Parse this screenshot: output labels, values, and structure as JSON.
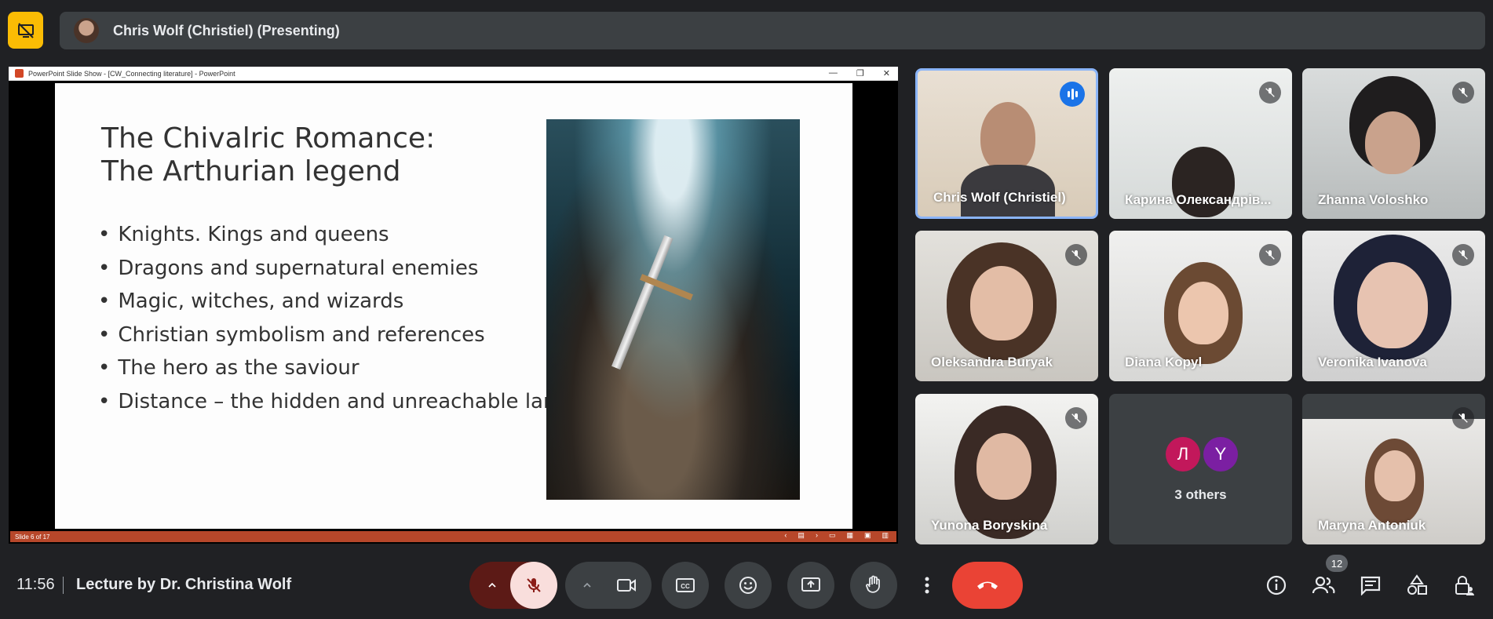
{
  "header": {
    "presenter_label": "Chris Wolf (Christiel) (Presenting)"
  },
  "shared_screen": {
    "window_title": "PowerPoint Slide Show - [CW_Connecting literature] - PowerPoint",
    "slide": {
      "title_line1": "The Chivalric Romance:",
      "title_line2": "The Arthurian legend",
      "bullets": [
        "Knights. Kings and queens",
        "Dragons and supernatural enemies",
        "Magic, witches, and wizards",
        "Christian symbolism and references",
        "The hero as the saviour",
        "Distance – the hidden and unreachable land"
      ]
    },
    "status_text": "Slide 6 of 17"
  },
  "participants": [
    {
      "name": "Chris Wolf (Christiel)",
      "speaking": true
    },
    {
      "name": "Карина Олександрів...",
      "muted": true
    },
    {
      "name": "Zhanna Voloshko",
      "muted": true
    },
    {
      "name": "Oleksandra Buryak",
      "muted": true
    },
    {
      "name": "Diana Kopyl",
      "muted": true
    },
    {
      "name": "Veronika Ivanova",
      "muted": true
    },
    {
      "name": "Yunona Boryskina",
      "muted": true
    },
    {
      "name": "Maryna Antoniuk",
      "muted": true
    }
  ],
  "others_tile": {
    "avatars": [
      {
        "letter": "Л",
        "color": "#c2185b"
      },
      {
        "letter": "Y",
        "color": "#7b1fa2"
      }
    ],
    "label": "3 others"
  },
  "bottom_bar": {
    "time": "11:56",
    "meeting_title": "Lecture by Dr. Christina Wolf",
    "people_count": "12"
  },
  "colors": {
    "background": "#202124",
    "surface": "#3c4043",
    "presenting_badge": "#fbbc04",
    "end_call": "#ea4335",
    "mic_off_bg": "#f9dedc",
    "accent": "#8ab4f8"
  }
}
